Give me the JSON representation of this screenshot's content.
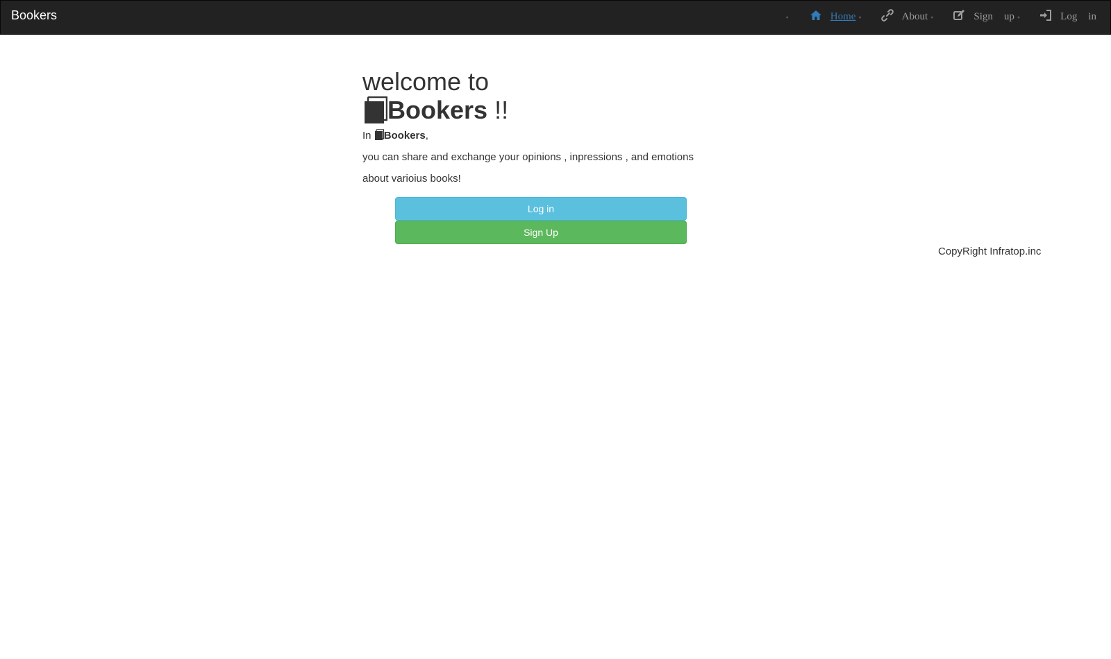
{
  "navbar": {
    "brand": "Bookers",
    "items": [
      {
        "label_1": "Home",
        "label_2": "",
        "icon": "home-icon",
        "active": true
      },
      {
        "label_1": "About",
        "label_2": "",
        "icon": "link-icon",
        "active": false
      },
      {
        "label_1": "Sign",
        "label_2": "up",
        "icon": "edit-icon",
        "active": false
      },
      {
        "label_1": "Log",
        "label_2": "in",
        "icon": "login-icon",
        "active": false
      }
    ],
    "colors": {
      "background": "#222222",
      "link": "#9d9d9d",
      "active": "#337ab7"
    }
  },
  "hero": {
    "line1": "welcome to",
    "brand": "Bookers",
    "exclaim": "!!",
    "intro_prefix": "In",
    "intro_brand": "Bookers",
    "intro_suffix": ",",
    "line2": "you can share and exchange your opinions , inpressions , and emotions",
    "line3": "about varioius books!",
    "icon": "book-icon"
  },
  "buttons": {
    "login": {
      "label": "Log in",
      "color": "#5bc0de"
    },
    "signup": {
      "label": "Sign Up",
      "color": "#5cb85c"
    }
  },
  "footer": {
    "text": "CopyRight Infratop.inc"
  }
}
